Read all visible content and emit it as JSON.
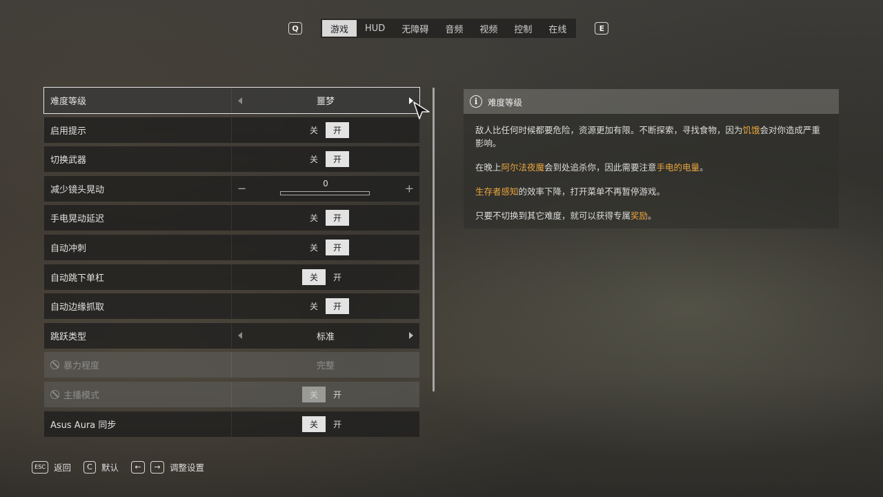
{
  "topnav": {
    "prev_key": "Q",
    "next_key": "E",
    "tabs": [
      "游戏",
      "HUD",
      "无障碍",
      "音频",
      "视频",
      "控制",
      "在线"
    ],
    "active_tab": 0
  },
  "settings": {
    "difficulty": {
      "label": "难度等级",
      "value": "噩梦"
    },
    "hints": {
      "label": "启用提示",
      "off": "关",
      "on": "开",
      "state": "on"
    },
    "switch_weapon": {
      "label": "切换武器",
      "off": "关",
      "on": "开",
      "state": "on"
    },
    "camera_shake": {
      "label": "减少镜头晃动",
      "value": "0",
      "minus": "−",
      "plus": "+",
      "level": 0
    },
    "flashlight_delay": {
      "label": "手电晃动延迟",
      "off": "关",
      "on": "开",
      "state": "on"
    },
    "auto_sprint": {
      "label": "自动冲刺",
      "off": "关",
      "on": "开",
      "state": "on"
    },
    "auto_drop": {
      "label": "自动跳下单杠",
      "off": "关",
      "on": "开",
      "state": "off"
    },
    "auto_grab": {
      "label": "自动边缘抓取",
      "off": "关",
      "on": "开",
      "state": "on"
    },
    "jump_type": {
      "label": "跳跃类型",
      "value": "标准"
    },
    "violence": {
      "label": "暴力程度",
      "value": "完整",
      "disabled": true
    },
    "streamer": {
      "label": "主播模式",
      "off": "关",
      "on": "开",
      "state": "off",
      "disabled": true
    },
    "aura": {
      "label": "Asus Aura 同步",
      "off": "关",
      "on": "开",
      "state": "off"
    }
  },
  "info": {
    "title": "难度等级",
    "icon": "info-icon",
    "p1_a": "敌人比任何时候都要危险，资源更加有限。不断探索，寻找食物，因为",
    "p1_hl": "饥饿",
    "p1_b": "会对你造成严重影响。",
    "p2_a": "在晚上",
    "p2_hl1": "阿尔法夜魔",
    "p2_b": "会到处追杀你，因此需要注意",
    "p2_hl2": "手电的电量",
    "p2_c": "。",
    "p3_hl": "生存者感知",
    "p3_b": "的效率下降，打开菜单不再暂停游戏。",
    "p4_a": "只要不切换到其它难度，就可以获得专属",
    "p4_hl": "奖励",
    "p4_b": "。",
    "highlight_color": "#e9a53e"
  },
  "footer": {
    "back_key": "ESC",
    "back_label": "返回",
    "default_key": "C",
    "default_label": "默认",
    "adjust_left_key": "←",
    "adjust_right_key": "→",
    "adjust_label": "调整设置"
  }
}
